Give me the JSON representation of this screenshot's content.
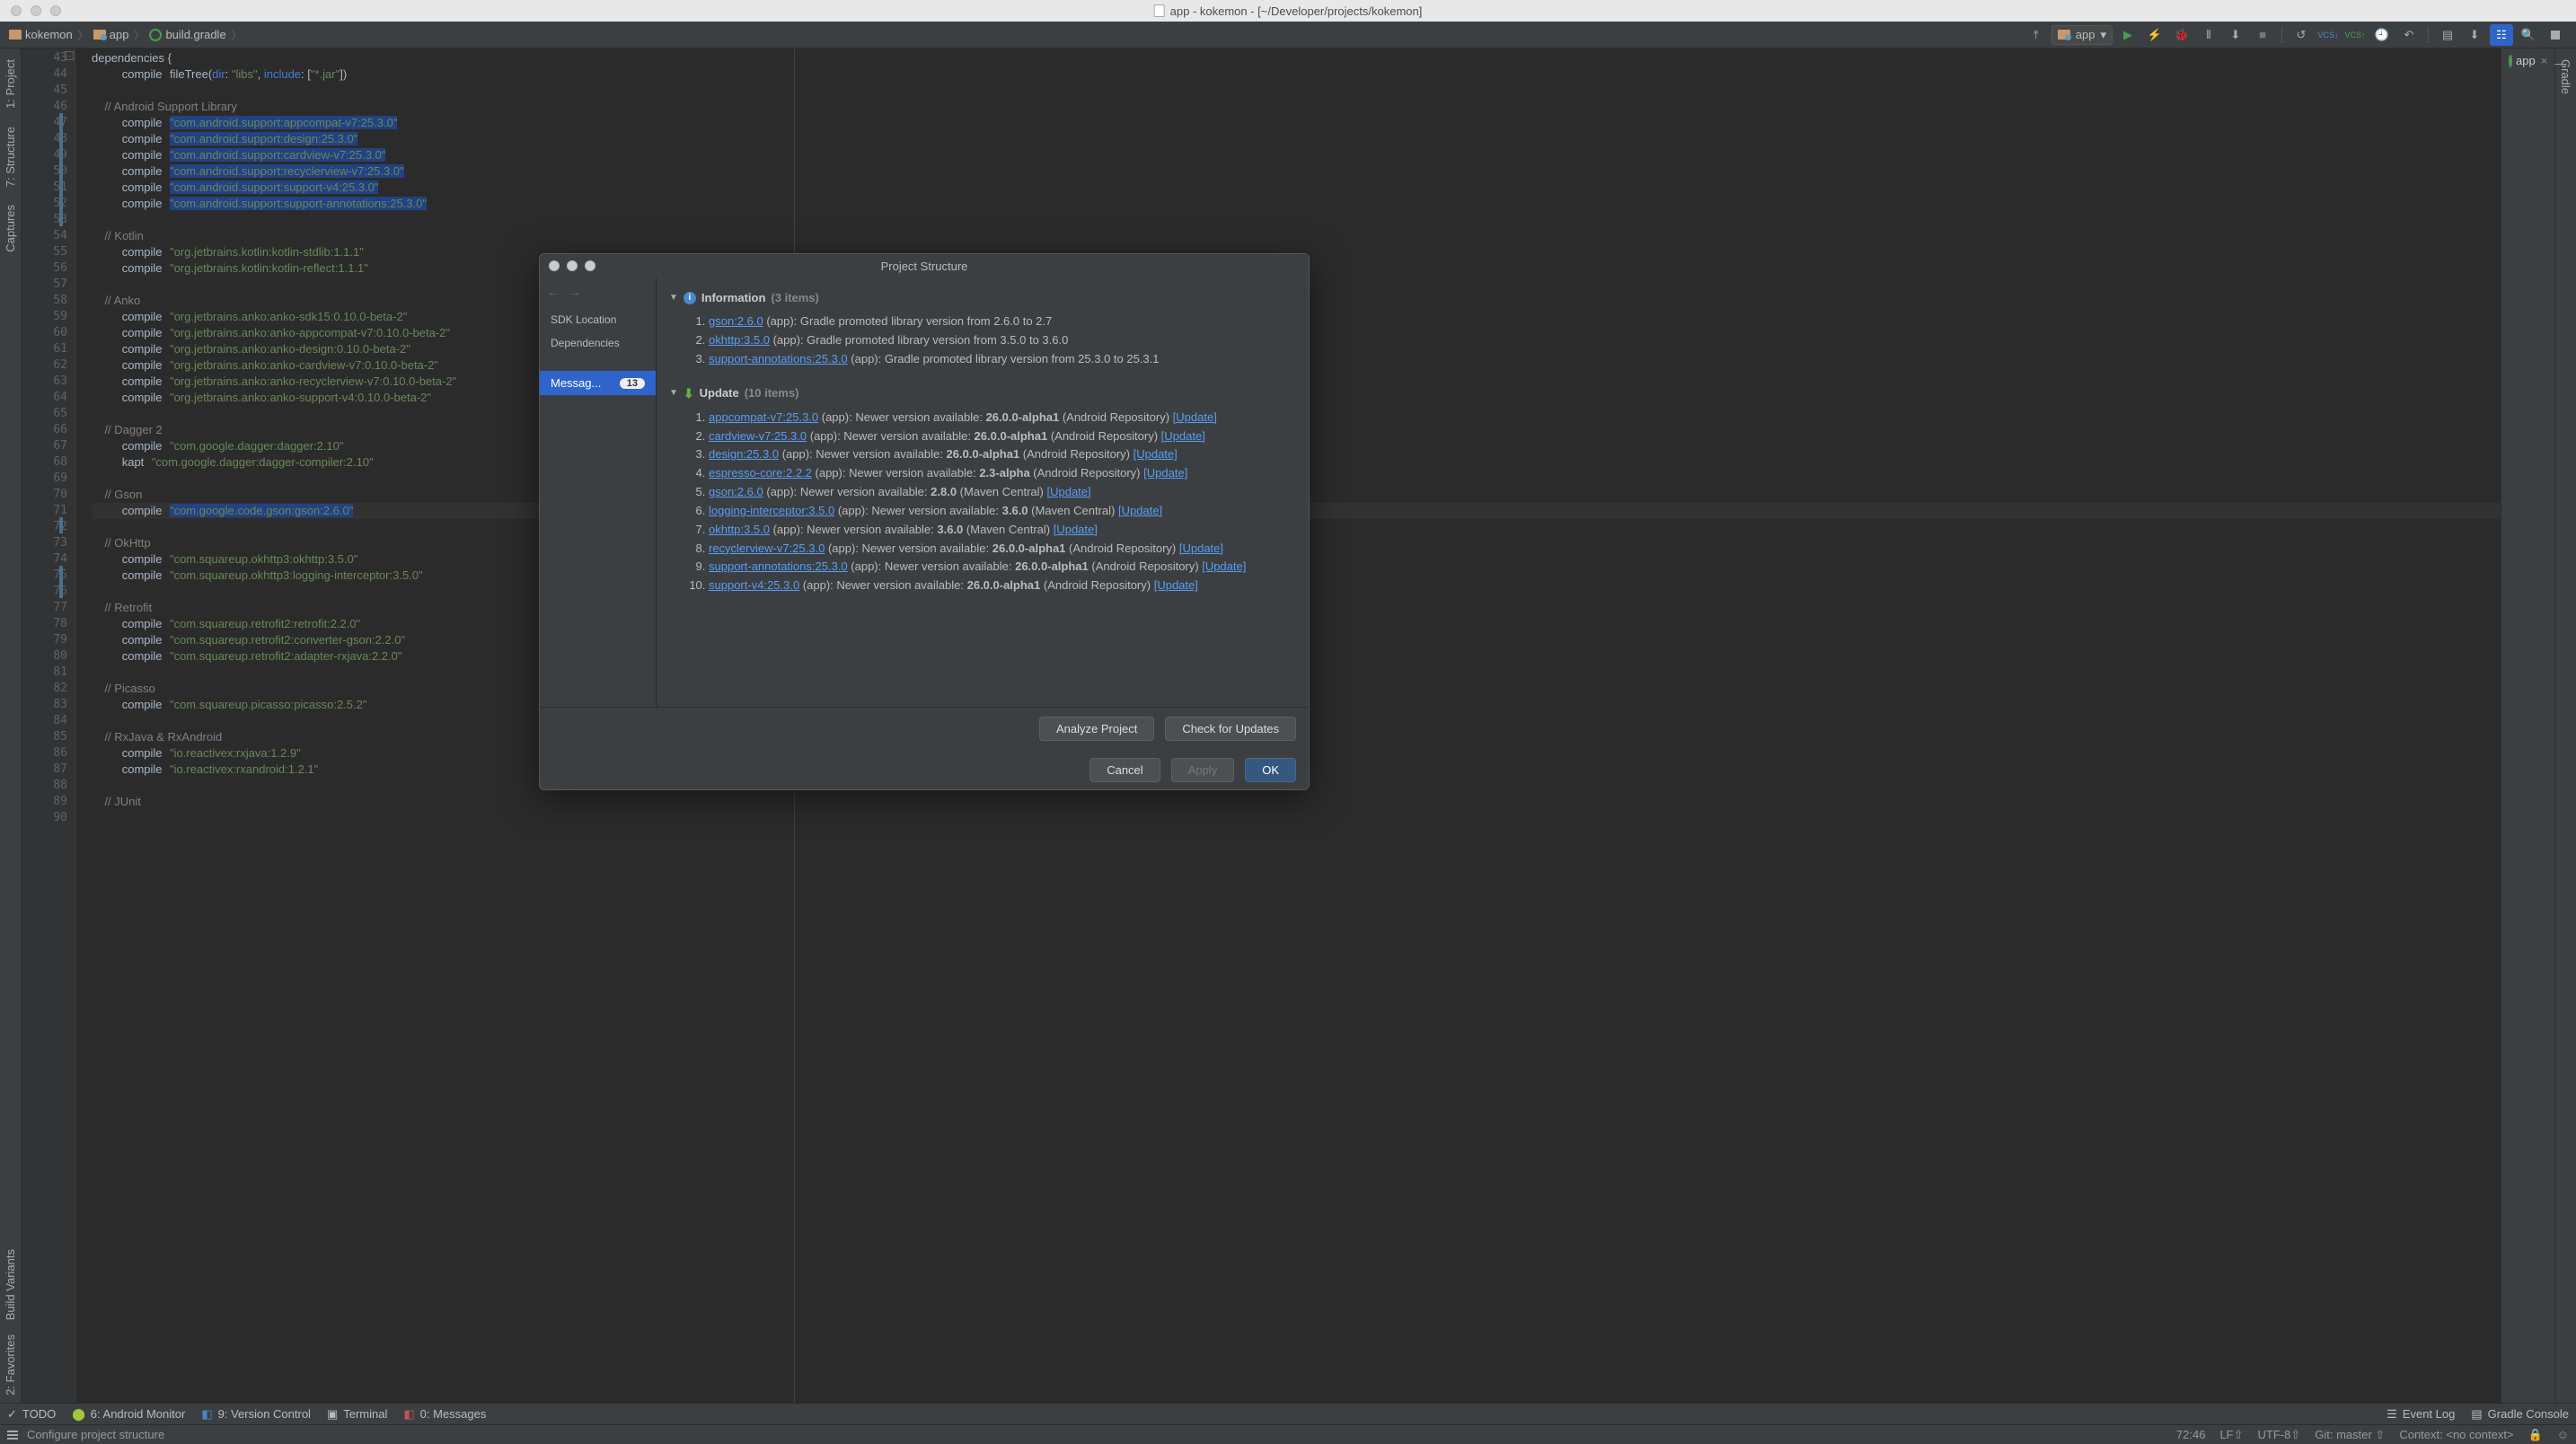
{
  "window": {
    "title": "app - kokemon - [~/Developer/projects/kokemon]"
  },
  "breadcrumb": {
    "root": "kokemon",
    "module": "app",
    "file": "build.gradle"
  },
  "run_config": "app",
  "right_panel": {
    "tab": "app"
  },
  "sidebar_left": [
    "1: Project",
    "7: Structure",
    "Captures",
    "Build Variants",
    "2: Favorites"
  ],
  "sidebar_right": [
    "Gradle"
  ],
  "gutter": {
    "start": 43,
    "end": 90
  },
  "code": [
    {
      "t": "dependencies {",
      "cls": "pn",
      "fold": true
    },
    {
      "t": "    compile fileTree(dir: \"libs\", include: [\"*.jar\"])"
    },
    {
      "t": ""
    },
    {
      "t": "    // Android Support Library",
      "cls": "cmt"
    },
    {
      "t": "    compile ",
      "s": "\"com.android.support:appcompat-v7:25.3.0\"",
      "hl": true
    },
    {
      "t": "    compile ",
      "s": "\"com.android.support:design:25.3.0\"",
      "hl": true
    },
    {
      "t": "    compile ",
      "s": "\"com.android.support:cardview-v7:25.3.0\"",
      "hl": true
    },
    {
      "t": "    compile ",
      "s": "\"com.android.support:recyclerview-v7:25.3.0\"",
      "hl": true
    },
    {
      "t": "    compile ",
      "s": "\"com.android.support:support-v4:25.3.0\"",
      "hl": true
    },
    {
      "t": "    compile ",
      "s": "\"com.android.support:support-annotations:25.3.0\"",
      "hl": true
    },
    {
      "t": ""
    },
    {
      "t": "    // Kotlin",
      "cls": "cmt"
    },
    {
      "t": "    compile ",
      "s": "\"org.jetbrains.kotlin:kotlin-stdlib:1.1.1\""
    },
    {
      "t": "    compile ",
      "s": "\"org.jetbrains.kotlin:kotlin-reflect:1.1.1\""
    },
    {
      "t": ""
    },
    {
      "t": "    // Anko",
      "cls": "cmt"
    },
    {
      "t": "    compile ",
      "s": "\"org.jetbrains.anko:anko-sdk15:0.10.0-beta-2\""
    },
    {
      "t": "    compile ",
      "s": "\"org.jetbrains.anko:anko-appcompat-v7:0.10.0-beta-2\""
    },
    {
      "t": "    compile ",
      "s": "\"org.jetbrains.anko:anko-design:0.10.0-beta-2\""
    },
    {
      "t": "    compile ",
      "s": "\"org.jetbrains.anko:anko-cardview-v7:0.10.0-beta-2\""
    },
    {
      "t": "    compile ",
      "s": "\"org.jetbrains.anko:anko-recyclerview-v7:0.10.0-beta-2\""
    },
    {
      "t": "    compile ",
      "s": "\"org.jetbrains.anko:anko-support-v4:0.10.0-beta-2\""
    },
    {
      "t": ""
    },
    {
      "t": "    // Dagger 2",
      "cls": "cmt"
    },
    {
      "t": "    compile ",
      "s": "\"com.google.dagger:dagger:2.10\""
    },
    {
      "t": "    kapt ",
      "s": "\"com.google.dagger:dagger-compiler:2.10\""
    },
    {
      "t": ""
    },
    {
      "t": "    // Gson",
      "cls": "cmt"
    },
    {
      "t": "    compile ",
      "s": "\"com.google.code.gson:gson:2.6.0\"",
      "hl": true,
      "caret": true
    },
    {
      "t": ""
    },
    {
      "t": "    // OkHttp",
      "cls": "cmt"
    },
    {
      "t": "    compile ",
      "s": "\"com.squareup.okhttp3:okhttp:3.5.0\""
    },
    {
      "t": "    compile ",
      "s": "\"com.squareup.okhttp3:logging-interceptor:3.5.0\""
    },
    {
      "t": ""
    },
    {
      "t": "    // Retrofit",
      "cls": "cmt"
    },
    {
      "t": "    compile ",
      "s": "\"com.squareup.retrofit2:retrofit:2.2.0\""
    },
    {
      "t": "    compile ",
      "s": "\"com.squareup.retrofit2:converter-gson:2.2.0\""
    },
    {
      "t": "    compile ",
      "s": "\"com.squareup.retrofit2:adapter-rxjava:2.2.0\""
    },
    {
      "t": ""
    },
    {
      "t": "    // Picasso",
      "cls": "cmt"
    },
    {
      "t": "    compile ",
      "s": "\"com.squareup.picasso:picasso:2.5.2\""
    },
    {
      "t": ""
    },
    {
      "t": "    // RxJava & RxAndroid",
      "cls": "cmt"
    },
    {
      "t": "    compile ",
      "s": "\"io.reactivex:rxjava:1.2.9\""
    },
    {
      "t": "    compile ",
      "s": "\"io.reactivex:rxandroid:1.2.1\""
    },
    {
      "t": ""
    },
    {
      "t": "    // JUnit",
      "cls": "cmt"
    }
  ],
  "dialog": {
    "title": "Project Structure",
    "side": {
      "sdk": "SDK Location",
      "deps": "Dependencies",
      "msg": "Messag...",
      "badge": "13"
    },
    "info": {
      "header": "Information",
      "count": "(3 items)",
      "items": [
        {
          "link": "gson:2.6.0",
          "txt": " (app): Gradle promoted library version from 2.6.0 to 2.7"
        },
        {
          "link": "okhttp:3.5.0",
          "txt": " (app): Gradle promoted library version from 3.5.0 to 3.6.0"
        },
        {
          "link": "support-annotations:25.3.0",
          "txt": " (app): Gradle promoted library version from 25.3.0 to 25.3.1"
        }
      ]
    },
    "update": {
      "header": "Update",
      "count": "(10 items)",
      "items": [
        {
          "link": "appcompat-v7:25.3.0",
          "txt": " (app): Newer version available: ",
          "v": "26.0.0-alpha1",
          "src": " (Android Repository) "
        },
        {
          "link": "cardview-v7:25.3.0",
          "txt": " (app): Newer version available: ",
          "v": "26.0.0-alpha1",
          "src": " (Android Repository) "
        },
        {
          "link": "design:25.3.0",
          "txt": " (app): Newer version available: ",
          "v": "26.0.0-alpha1",
          "src": " (Android Repository) "
        },
        {
          "link": "espresso-core:2.2.2",
          "txt": " (app): Newer version available: ",
          "v": "2.3-alpha",
          "src": " (Android Repository) "
        },
        {
          "link": "gson:2.6.0",
          "txt": " (app): Newer version available: ",
          "v": "2.8.0",
          "src": " (Maven Central) "
        },
        {
          "link": "logging-interceptor:3.5.0",
          "txt": " (app): Newer version available: ",
          "v": "3.6.0",
          "src": " (Maven Central) "
        },
        {
          "link": "okhttp:3.5.0",
          "txt": " (app): Newer version available: ",
          "v": "3.6.0",
          "src": " (Maven Central) "
        },
        {
          "link": "recyclerview-v7:25.3.0",
          "txt": " (app): Newer version available: ",
          "v": "26.0.0-alpha1",
          "src": " (Android Repository) "
        },
        {
          "link": "support-annotations:25.3.0",
          "txt": " (app): Newer version available: ",
          "v": "26.0.0-alpha1",
          "src": " (Android Repository) "
        },
        {
          "link": "support-v4:25.3.0",
          "txt": " (app): Newer version available: ",
          "v": "26.0.0-alpha1",
          "src": " (Android Repository) "
        }
      ],
      "update_label": "[Update]"
    },
    "buttons": {
      "analyze": "Analyze Project",
      "check": "Check for Updates",
      "cancel": "Cancel",
      "apply": "Apply",
      "ok": "OK"
    }
  },
  "bottom": {
    "todo": "TODO",
    "monitor": "6: Android Monitor",
    "vcs": "9: Version Control",
    "terminal": "Terminal",
    "messages": "0: Messages",
    "eventlog": "Event Log",
    "gradlecon": "Gradle Console"
  },
  "status": {
    "hint": "Configure project structure",
    "pos": "72:46",
    "le": "LF⇧",
    "enc": "UTF-8⇧",
    "git": "Git: master ⇧",
    "ctx": "Context: <no context>",
    "lock": "🔒"
  }
}
